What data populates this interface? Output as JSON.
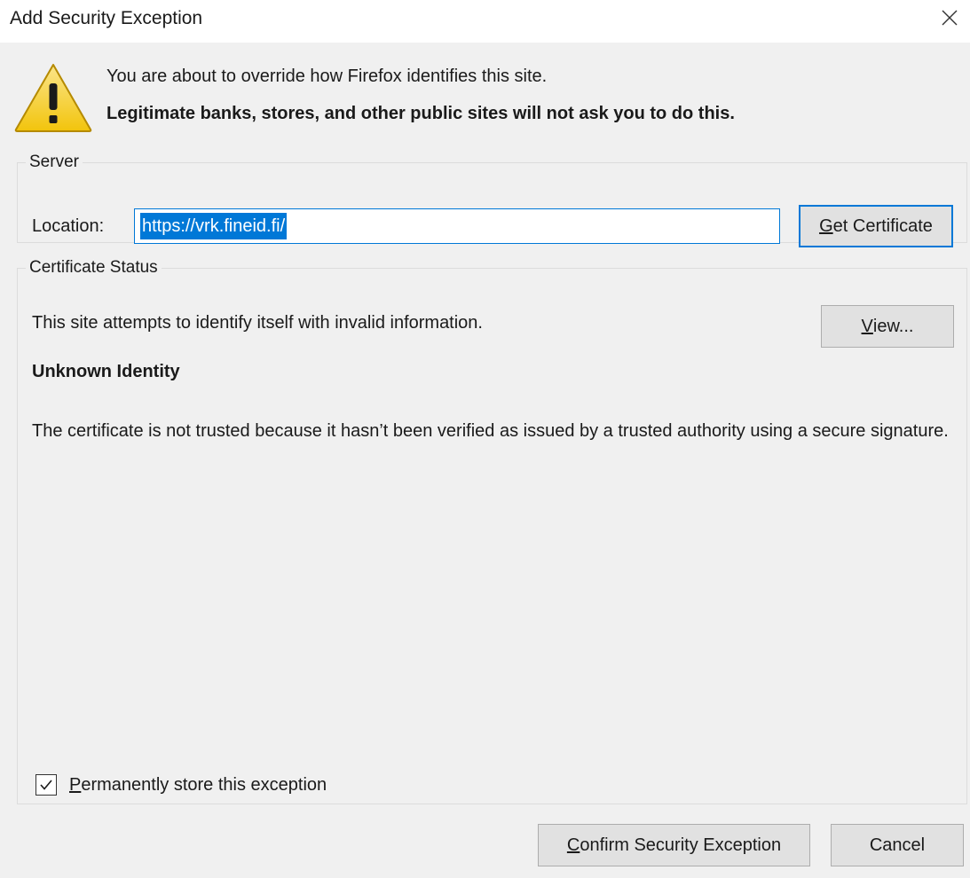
{
  "dialog": {
    "title": "Add Security Exception",
    "close_icon": "close-icon"
  },
  "warning": {
    "icon": "warning-triangle-icon",
    "line1": "You are about to override how Firefox identifies this site.",
    "line2": "Legitimate banks, stores, and other public sites will not ask you to do this."
  },
  "server": {
    "legend": "Server",
    "location_label": "Location:",
    "location_value": "https://vrk.fineid.fi/",
    "get_certificate_accel": "G",
    "get_certificate_rest": "et Certificate"
  },
  "status": {
    "legend": "Certificate Status",
    "text": "This site attempts to identify itself with invalid information.",
    "view_accel": "V",
    "view_rest": "iew...",
    "identity_title": "Unknown Identity",
    "identity_desc": "The certificate is not trusted because it hasn’t been verified as issued by a trusted authority using a secure signature."
  },
  "permanent": {
    "checked": true,
    "accel": "P",
    "rest": "ermanently store this exception"
  },
  "buttons": {
    "confirm_accel": "C",
    "confirm_rest": "onfirm Security Exception",
    "cancel": "Cancel"
  },
  "colors": {
    "accent": "#0078d7",
    "dialog_bg": "#f0f0f0",
    "button_bg": "#e1e1e1",
    "warning_yellow": "#f7d21e"
  }
}
